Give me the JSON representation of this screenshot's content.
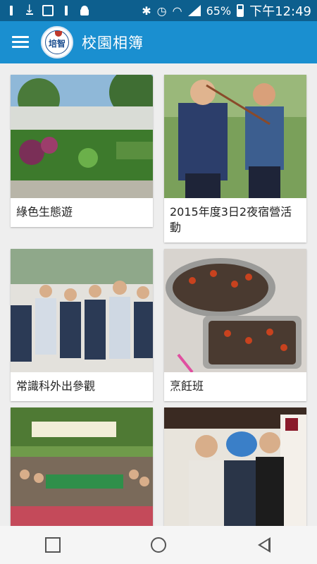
{
  "status_bar": {
    "battery_percent": "65%",
    "time": "下午12:49"
  },
  "app_bar": {
    "title": "校園相簿",
    "logo_text": "培智"
  },
  "albums": [
    {
      "caption": "綠色生態遊"
    },
    {
      "caption": "2015年度3日2夜宿營活動"
    },
    {
      "caption": "常識科外出參觀"
    },
    {
      "caption": "烹飪班"
    },
    {
      "caption": ""
    },
    {
      "caption": ""
    }
  ],
  "colors": {
    "status_bar": "#0d5f8e",
    "app_bar": "#1a8fd0",
    "background": "#eeeeee"
  }
}
